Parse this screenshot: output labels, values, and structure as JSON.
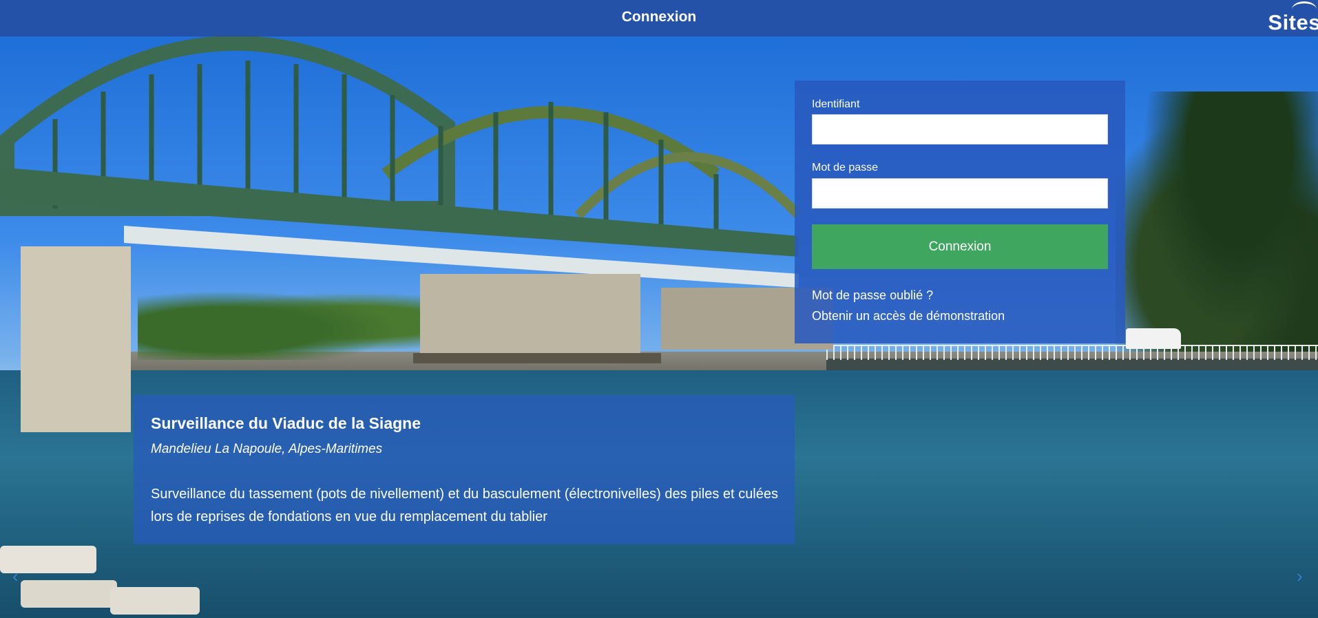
{
  "header": {
    "title": "Connexion",
    "brand": "Sites"
  },
  "login": {
    "username_label": "Identifiant",
    "username_value": "",
    "password_label": "Mot de passe",
    "password_value": "",
    "submit_label": "Connexion",
    "forgot_link": "Mot de passe oublié ?",
    "demo_link": "Obtenir un accès de démonstration"
  },
  "slide": {
    "title": "Surveillance du Viaduc de la Siagne",
    "location": "Mandelieu La Napoule, Alpes-Maritimes",
    "description": "Surveillance du tassement (pots de nivellement) et du basculement (électronivelles) des piles et culées lors de reprises de fondations en vue du remplacement du tablier"
  },
  "carousel": {
    "prev_icon": "‹",
    "next_icon": "›"
  },
  "colors": {
    "header": "#2452a8",
    "panel": "#285abe",
    "button": "#3fa660"
  }
}
